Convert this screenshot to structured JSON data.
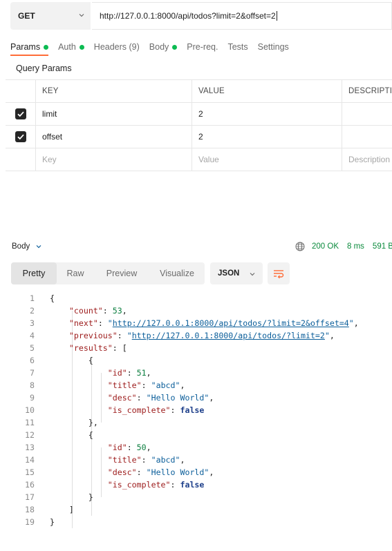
{
  "request": {
    "method": "GET",
    "url": "http://127.0.0.1:8000/api/todos?limit=2&offset=2"
  },
  "tabs": [
    {
      "label": "Params",
      "dot": true
    },
    {
      "label": "Auth",
      "dot": true
    },
    {
      "label": "Headers (9)",
      "dot": false
    },
    {
      "label": "Body",
      "dot": true
    },
    {
      "label": "Pre-req.",
      "dot": false
    },
    {
      "label": "Tests",
      "dot": false
    },
    {
      "label": "Settings",
      "dot": false
    }
  ],
  "query_params": {
    "title": "Query Params",
    "headers": {
      "key": "KEY",
      "value": "VALUE",
      "description": "DESCRIPTION"
    },
    "rows": [
      {
        "key": "limit",
        "value": "2",
        "checked": true
      },
      {
        "key": "offset",
        "value": "2",
        "checked": true
      }
    ],
    "placeholder": {
      "key": "Key",
      "value": "Value",
      "description": "Description"
    }
  },
  "response": {
    "body_label": "Body",
    "status": "200 OK",
    "time": "8 ms",
    "size": "591 B",
    "view_tabs": [
      "Pretty",
      "Raw",
      "Preview",
      "Visualize"
    ],
    "format": "JSON",
    "code_lines": [
      "1",
      "2",
      "3",
      "4",
      "5",
      "6",
      "7",
      "8",
      "9",
      "10",
      "11",
      "12",
      "13",
      "14",
      "15",
      "16",
      "17",
      "18",
      "19"
    ],
    "json": {
      "count": 53,
      "next_url": "http://127.0.0.1:8000/api/todos/?limit=2&offset=4",
      "previous_url": "http://127.0.0.1:8000/api/todos/?limit=2",
      "results": [
        {
          "id": 51,
          "title": "abcd",
          "desc": "Hello World",
          "is_complete": "false"
        },
        {
          "id": 50,
          "title": "abcd",
          "desc": "Hello World",
          "is_complete": "false"
        }
      ]
    }
  },
  "colors": {
    "accent": "#ff6c37",
    "status_green": "#0a8a3c",
    "dot_green": "#0cbb52"
  }
}
